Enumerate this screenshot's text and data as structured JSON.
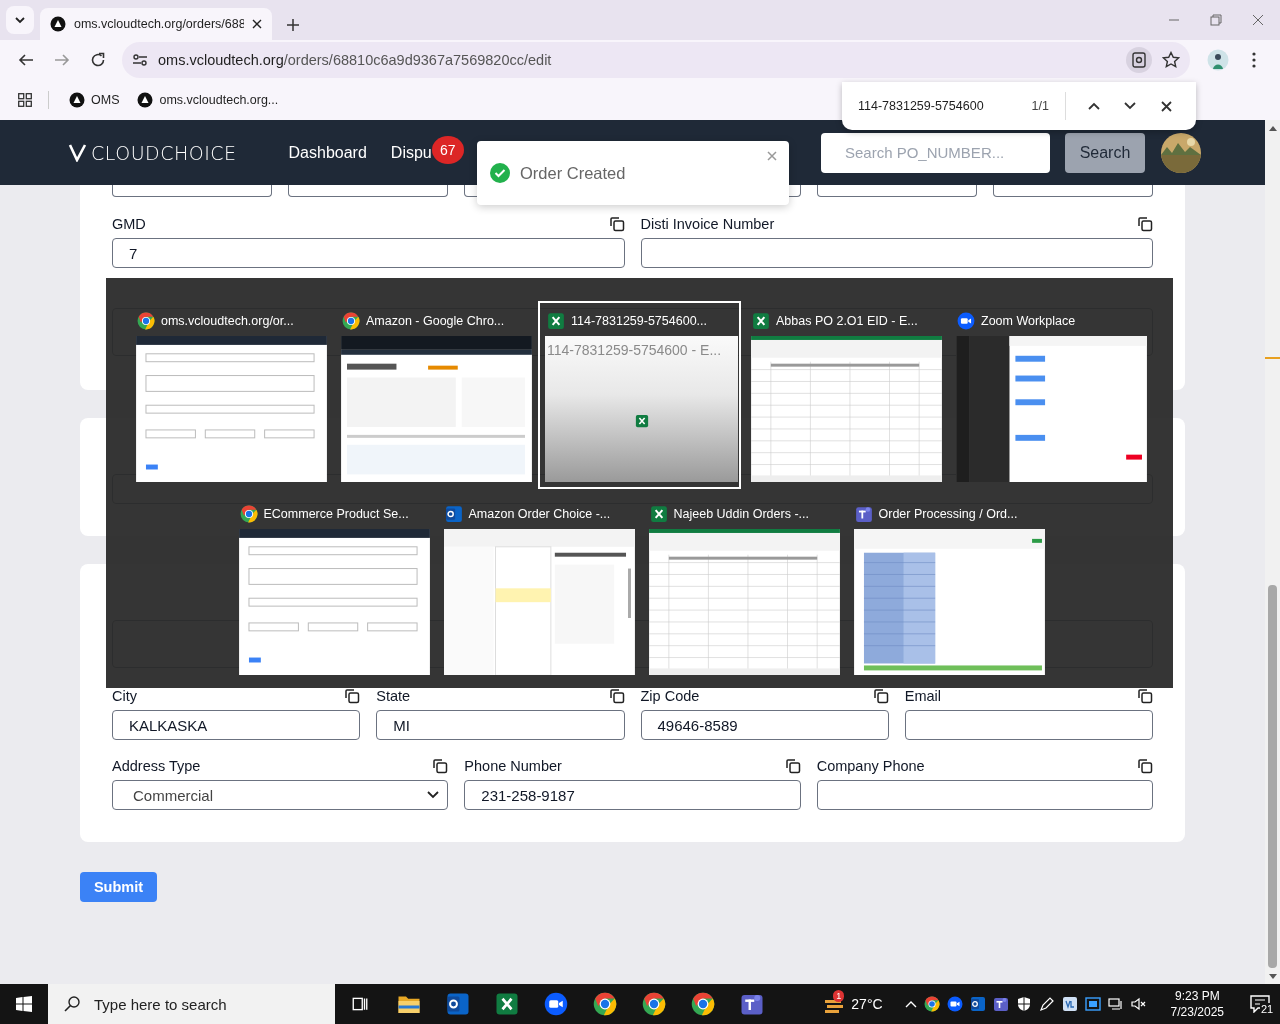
{
  "browser": {
    "tab_title": "oms.vcloudtech.org/orders/688",
    "url_host": "oms.vcloudtech.org",
    "url_path": "/orders/68810c6a9d9367a7569820cc/edit",
    "bookmarks": [
      "OMS",
      "oms.vcloudtech.org..."
    ]
  },
  "find_bar": {
    "query": "114-7831259-5754600",
    "count": "1/1"
  },
  "header": {
    "logo": "CLOUDCHOICE",
    "nav": [
      {
        "label": "Dashboard"
      },
      {
        "label": "Dispu",
        "badge": "67"
      }
    ],
    "search_placeholder": "Search PO_NUMBER...",
    "search_button": "Search"
  },
  "toast": {
    "message": "Order Created"
  },
  "order_card": {
    "fields": [
      {
        "label": "GMD",
        "value": "7"
      },
      {
        "label": "Disti Invoice Number"
      }
    ]
  },
  "shipping_card": {
    "row1": [
      {
        "label": "City",
        "value": "KALKASKA",
        "kind": "input"
      },
      {
        "label": "State",
        "value": "MI",
        "kind": "input"
      },
      {
        "label": "Zip Code",
        "value": "49646-8589",
        "kind": "input"
      },
      {
        "label": "Email",
        "kind": "input"
      }
    ],
    "row2": [
      {
        "label": "Address Type",
        "value": "Commercial",
        "kind": "select"
      },
      {
        "label": "Phone Number",
        "value": "231-258-9187",
        "kind": "input"
      },
      {
        "label": "Company Phone",
        "kind": "input"
      }
    ]
  },
  "submit": "Submit",
  "switcher": {
    "rows": [
      [
        {
          "title": "oms.vcloudtech.org/or...",
          "kind": "chrome",
          "selected": false
        },
        {
          "title": "Amazon - Google Chro...",
          "kind": "chrome",
          "selected": false
        },
        {
          "title": "114-7831259-5754600...",
          "kind": "excel",
          "selected": true,
          "preview": "114-7831259-5754600 - E..."
        },
        {
          "title": "Abbas PO 2.O1  EID - E...",
          "kind": "excel",
          "selected": false
        },
        {
          "title": "Zoom Workplace",
          "kind": "zoom",
          "selected": false
        }
      ],
      [
        {
          "title": "ECommerce Product Se...",
          "kind": "chrome",
          "selected": false
        },
        {
          "title": "Amazon Order Choice -...",
          "kind": "outlook",
          "selected": false
        },
        {
          "title": "Najeeb Uddin Orders -...",
          "kind": "excel",
          "selected": false
        },
        {
          "title": "Order Processing / Ord...",
          "kind": "teams",
          "selected": false
        }
      ]
    ]
  },
  "taskbar": {
    "search_placeholder": "Type here to search",
    "apps": [
      {
        "kind": "taskview"
      },
      {
        "kind": "explorer"
      },
      {
        "kind": "outlook"
      },
      {
        "kind": "excel"
      },
      {
        "kind": "zoom"
      },
      {
        "kind": "chrome"
      },
      {
        "kind": "chrome"
      },
      {
        "kind": "chrome"
      },
      {
        "kind": "teams"
      }
    ],
    "weather_alert": "1",
    "temperature": "27°C",
    "time": "9:23 PM",
    "date": "7/23/2025",
    "notifications": "21"
  }
}
